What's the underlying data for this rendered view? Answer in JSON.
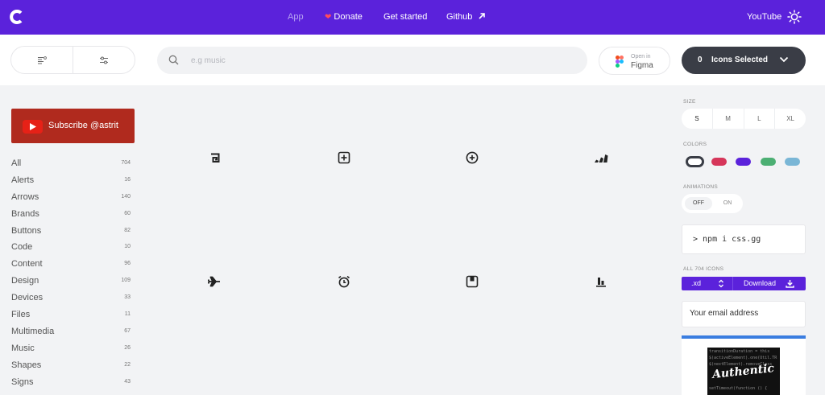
{
  "nav": {
    "logo": "css.gg-logo",
    "links": [
      {
        "label": "App",
        "active": false
      },
      {
        "label": "Donate",
        "icon": "heart-icon"
      },
      {
        "label": "Get started"
      },
      {
        "label": "Github",
        "icon": "arrow-up-right-icon"
      }
    ],
    "youtube_label": "YouTube",
    "theme_icon": "sun-icon"
  },
  "toolbar": {
    "view_icons": [
      "align-left-icon",
      "options-icon"
    ],
    "search_placeholder": "e.g music",
    "figma": {
      "small": "Open in",
      "big": "Figma"
    },
    "selected": {
      "count": "0",
      "label": "Icons Selected"
    }
  },
  "sidebar": {
    "subscribe_label": "Subscribe @astrit",
    "categories": [
      {
        "name": "All",
        "count": "704"
      },
      {
        "name": "Alerts",
        "count": "16"
      },
      {
        "name": "Arrows",
        "count": "140"
      },
      {
        "name": "Brands",
        "count": "60"
      },
      {
        "name": "Buttons",
        "count": "82"
      },
      {
        "name": "Code",
        "count": "10"
      },
      {
        "name": "Content",
        "count": "96"
      },
      {
        "name": "Design",
        "count": "109"
      },
      {
        "name": "Devices",
        "count": "33"
      },
      {
        "name": "Files",
        "count": "11"
      },
      {
        "name": "Multimedia",
        "count": "67"
      },
      {
        "name": "Music",
        "count": "26"
      },
      {
        "name": "Shapes",
        "count": "22"
      },
      {
        "name": "Signs",
        "count": "43"
      }
    ]
  },
  "grid": {
    "icons": [
      "abstract-icon",
      "add-r-icon",
      "add-icon",
      "adidas-icon",
      "airplane-icon",
      "alarm-icon",
      "album-icon",
      "align-bottom-icon"
    ]
  },
  "panel": {
    "size_label": "SIZE",
    "sizes": [
      "S",
      "M",
      "L",
      "XL"
    ],
    "selected_size": "S",
    "colors_label": "COLORS",
    "colors": [
      "#3a3d46",
      "#d6365a",
      "#5b22db",
      "#4caf73",
      "#7ab6d6"
    ],
    "animations_label": "ANIMATIONS",
    "anim_off": "OFF",
    "anim_on": "ON",
    "npm_command": "> npm i css.gg",
    "all_icons_label": "ALL 704 ICONS",
    "format": ".xd",
    "download_label": "Download",
    "email_placeholder": "Your email address",
    "ad_text": "Authentic",
    "ad_code": [
      "transitionDuration = this",
      "$(activeElement).one(Util.TR",
      "$(nextElement).removeClass",
      "setTimeout(function () {"
    ]
  }
}
